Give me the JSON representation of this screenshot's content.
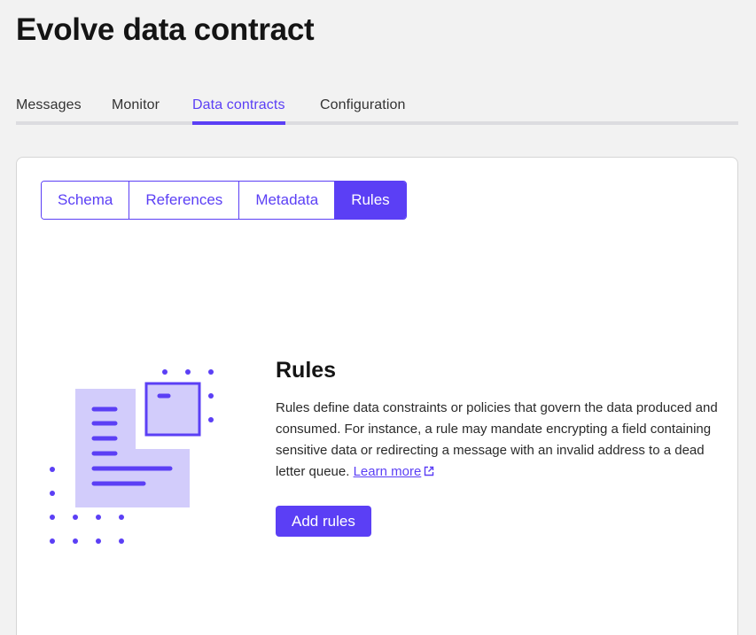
{
  "header": {
    "title": "Evolve data contract"
  },
  "tabs": [
    {
      "label": "Messages"
    },
    {
      "label": "Monitor"
    },
    {
      "label": "Data contracts"
    },
    {
      "label": "Configuration"
    }
  ],
  "subtabs": [
    {
      "label": "Schema"
    },
    {
      "label": "References"
    },
    {
      "label": "Metadata"
    },
    {
      "label": "Rules"
    }
  ],
  "rules": {
    "title": "Rules",
    "description": "Rules define data constraints or policies that govern the data produced and consumed. For instance, a rule may mandate encrypting a field containing sensitive data or redirecting a message with an invalid address to a dead letter queue.",
    "learn_more": "Learn more",
    "add_button": "Add rules"
  },
  "colors": {
    "accent": "#5b3ff5",
    "illustration_fill": "#d2ccfb",
    "background": "#f2f2f2"
  }
}
